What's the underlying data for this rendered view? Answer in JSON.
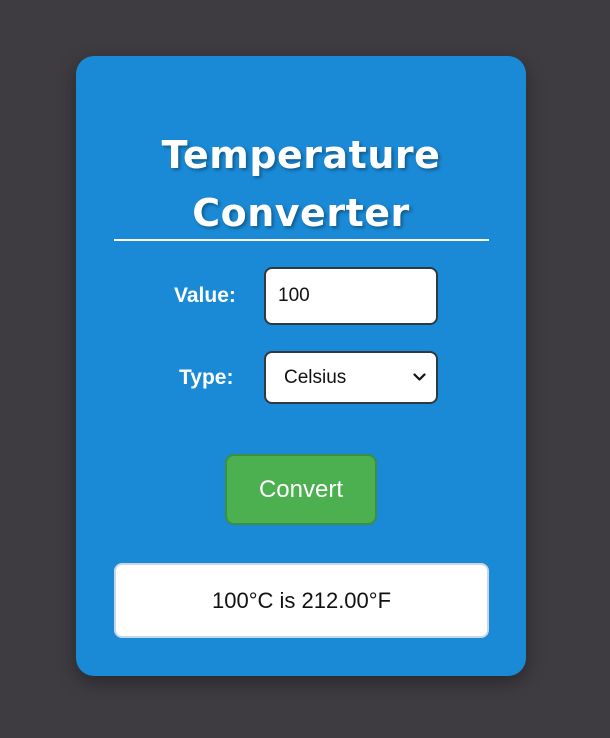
{
  "app": {
    "title": "Temperature Converter"
  },
  "form": {
    "value_label": "Value:",
    "value_input": "100",
    "type_label": "Type:",
    "type_selected": "Celsius"
  },
  "actions": {
    "convert_label": "Convert"
  },
  "result": {
    "text": "100°C is 212.00°F"
  },
  "colors": {
    "background": "#3e3c41",
    "card": "#1a8ad6",
    "button": "#4caf50",
    "text_light": "#ffffff"
  },
  "icons": {
    "select_arrow": "chevron-down-icon"
  }
}
